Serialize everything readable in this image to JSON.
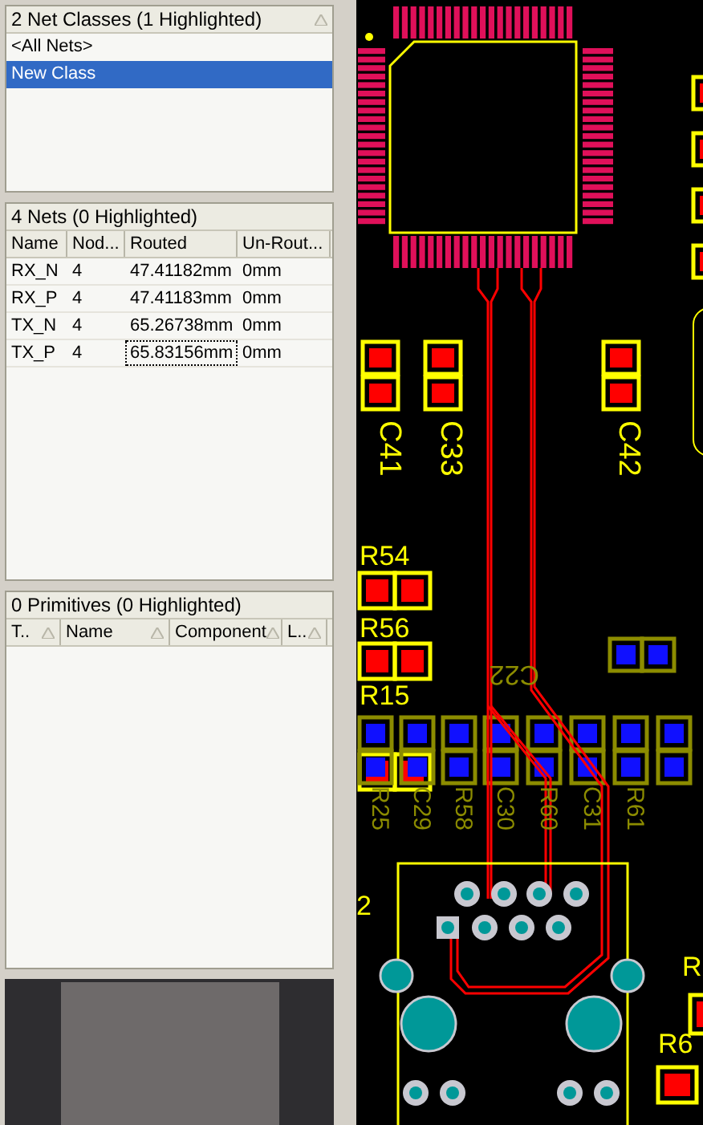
{
  "net_classes": {
    "title": "2 Net Classes (1 Highlighted)",
    "items": [
      {
        "label": "<All Nets>",
        "selected": false
      },
      {
        "label": "New Class",
        "selected": true
      }
    ]
  },
  "nets": {
    "title": "4 Nets (0 Highlighted)",
    "columns": [
      "Name",
      "Nod...",
      "Routed",
      "Un-Rout..."
    ],
    "rows": [
      {
        "cells": [
          "RX_N",
          "4",
          "47.41182mm",
          "0mm"
        ],
        "focused": false
      },
      {
        "cells": [
          "RX_P",
          "4",
          "47.41183mm",
          "0mm"
        ],
        "focused": false
      },
      {
        "cells": [
          "TX_N",
          "4",
          "65.26738mm",
          "0mm"
        ],
        "focused": false
      },
      {
        "cells": [
          "TX_P",
          "4",
          "65.83156mm",
          "0mm"
        ],
        "focused": true
      }
    ]
  },
  "primitives": {
    "title": "0 Primitives (0 Highlighted)",
    "columns": [
      "T..",
      "Name",
      "Component",
      "L.."
    ]
  },
  "pcb": {
    "top_labels": [
      {
        "text": "C41",
        "kind": "vertical"
      },
      {
        "text": "C33",
        "kind": "vertical"
      },
      {
        "text": "C42",
        "kind": "vertical"
      },
      {
        "text": "R54",
        "kind": "horizontal"
      },
      {
        "text": "R56",
        "kind": "horizontal"
      },
      {
        "text": "R15",
        "kind": "horizontal"
      },
      {
        "text": "2",
        "kind": "horizontal"
      },
      {
        "text": "R",
        "kind": "horizontal"
      },
      {
        "text": "R6",
        "kind": "horizontal"
      }
    ],
    "bottom_labels": [
      "C22",
      "R25",
      "C29",
      "R58",
      "C30",
      "R60",
      "C31",
      "R61"
    ]
  }
}
